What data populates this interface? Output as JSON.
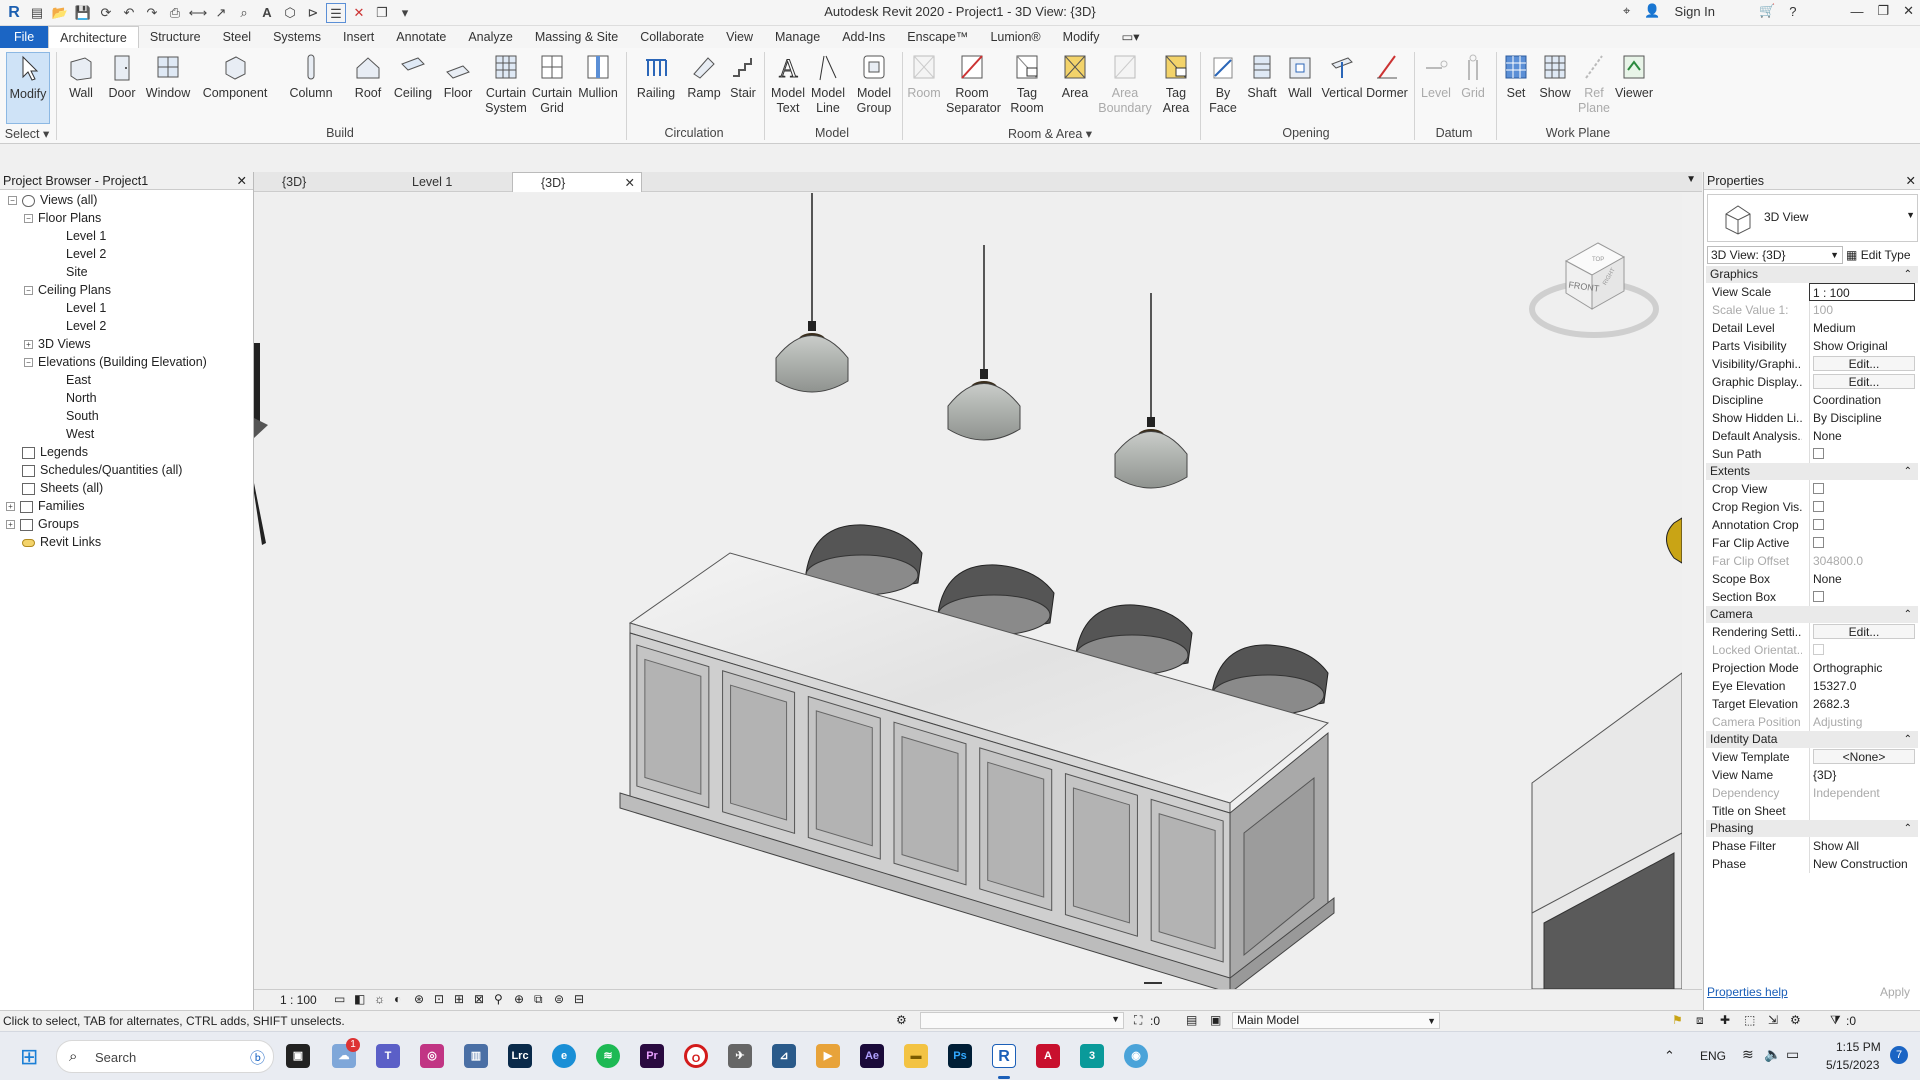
{
  "window": {
    "title": "Autodesk Revit 2020 - Project1 - 3D View: {3D}",
    "sign_in": "Sign In"
  },
  "menu": {
    "items": [
      "File",
      "Architecture",
      "Structure",
      "Steel",
      "Systems",
      "Insert",
      "Annotate",
      "Analyze",
      "Massing & Site",
      "Collaborate",
      "View",
      "Manage",
      "Add-Ins",
      "Enscape™",
      "Lumion®",
      "Modify"
    ]
  },
  "ribbon": {
    "select": {
      "modify": "Modify",
      "panel": "Select"
    },
    "build": {
      "wall": "Wall",
      "door": "Door",
      "window": "Window",
      "component": "Component",
      "column": "Column",
      "roof": "Roof",
      "ceiling": "Ceiling",
      "floor": "Floor",
      "curtain_system": "Curtain System",
      "curtain_grid": "Curtain Grid",
      "mullion": "Mullion",
      "panel": "Build"
    },
    "circulation": {
      "railing": "Railing",
      "ramp": "Ramp",
      "stair": "Stair",
      "panel": "Circulation"
    },
    "model": {
      "model_text": "Model Text",
      "model_line": "Model Line",
      "model_group": "Model Group",
      "panel": "Model"
    },
    "room_area": {
      "room": "Room",
      "room_separator": "Room Separator",
      "tag_room": "Tag Room",
      "area": "Area",
      "area_boundary": "Area Boundary",
      "tag_area": "Tag Area",
      "panel": "Room & Area"
    },
    "opening": {
      "by_face": "By Face",
      "shaft": "Shaft",
      "wall": "Wall",
      "vertical": "Vertical",
      "dormer": "Dormer",
      "panel": "Opening"
    },
    "datum": {
      "level": "Level",
      "grid": "Grid",
      "panel": "Datum"
    },
    "work_plane": {
      "set": "Set",
      "show": "Show",
      "ref_plane": "Ref Plane",
      "viewer": "Viewer",
      "panel": "Work Plane"
    }
  },
  "project_browser": {
    "title": "Project Browser - Project1",
    "nodes": [
      {
        "label": "Views (all)"
      },
      {
        "label": "Floor Plans"
      },
      {
        "label": "Level 1"
      },
      {
        "label": "Level 2"
      },
      {
        "label": "Site"
      },
      {
        "label": "Ceiling Plans"
      },
      {
        "label": "Level 1"
      },
      {
        "label": "Level 2"
      },
      {
        "label": "3D Views"
      },
      {
        "label": "Elevations (Building Elevation)"
      },
      {
        "label": "East"
      },
      {
        "label": "North"
      },
      {
        "label": "South"
      },
      {
        "label": "West"
      },
      {
        "label": "Legends"
      },
      {
        "label": "Schedules/Quantities (all)"
      },
      {
        "label": "Sheets (all)"
      },
      {
        "label": "Families"
      },
      {
        "label": "Groups"
      },
      {
        "label": "Revit Links"
      }
    ]
  },
  "view_tabs": [
    {
      "label": "{3D}"
    },
    {
      "label": "Level 1"
    },
    {
      "label": "{3D}"
    }
  ],
  "viewcube": {
    "front": "FRONT",
    "top": "TOP",
    "right": "RIGHT"
  },
  "view_control": {
    "scale": "1 : 100",
    "zero": "0"
  },
  "properties": {
    "title": "Properties",
    "type_name": "3D View",
    "instance_selector": "3D View: {3D}",
    "edit_type": "Edit Type",
    "sections": {
      "graphics": "Graphics",
      "extents": "Extents",
      "camera": "Camera",
      "identity": "Identity Data",
      "phasing": "Phasing"
    },
    "graphics": [
      {
        "k": "View Scale",
        "v": "1 : 100"
      },
      {
        "k": "Scale Value    1:",
        "v": "100"
      },
      {
        "k": "Detail Level",
        "v": "Medium"
      },
      {
        "k": "Parts Visibility",
        "v": "Show Original"
      },
      {
        "k": "Visibility/Graphi...",
        "v": "Edit..."
      },
      {
        "k": "Graphic Display...",
        "v": "Edit..."
      },
      {
        "k": "Discipline",
        "v": "Coordination"
      },
      {
        "k": "Show Hidden Li...",
        "v": "By Discipline"
      },
      {
        "k": "Default Analysis...",
        "v": "None"
      },
      {
        "k": "Sun Path",
        "v": ""
      }
    ],
    "extents": [
      {
        "k": "Crop View",
        "v": ""
      },
      {
        "k": "Crop Region Vis...",
        "v": ""
      },
      {
        "k": "Annotation Crop",
        "v": ""
      },
      {
        "k": "Far Clip Active",
        "v": ""
      },
      {
        "k": "Far Clip Offset",
        "v": "304800.0"
      },
      {
        "k": "Scope Box",
        "v": "None"
      },
      {
        "k": "Section Box",
        "v": ""
      }
    ],
    "camera": [
      {
        "k": "Rendering Setti...",
        "v": "Edit..."
      },
      {
        "k": "Locked Orientat...",
        "v": ""
      },
      {
        "k": "Projection Mode",
        "v": "Orthographic"
      },
      {
        "k": "Eye Elevation",
        "v": "15327.0"
      },
      {
        "k": "Target Elevation",
        "v": "2682.3"
      },
      {
        "k": "Camera Position",
        "v": "Adjusting"
      }
    ],
    "identity": [
      {
        "k": "View Template",
        "v": "<None>"
      },
      {
        "k": "View Name",
        "v": "{3D}"
      },
      {
        "k": "Dependency",
        "v": "Independent"
      },
      {
        "k": "Title on Sheet",
        "v": ""
      }
    ],
    "phasing": [
      {
        "k": "Phase Filter",
        "v": "Show All"
      },
      {
        "k": "Phase",
        "v": "New Construction"
      }
    ],
    "help": "Properties help",
    "apply": "Apply"
  },
  "status": {
    "hint": "Click to select, TAB for alternates, CTRL adds, SHIFT unselects.",
    "workset_count": ":0",
    "model": "Main Model",
    "filter_count": ":0"
  },
  "taskbar": {
    "search": "Search",
    "lang": "ENG",
    "time": "1:15 PM",
    "date": "5/15/2023",
    "notif": "7",
    "badge": "1"
  }
}
